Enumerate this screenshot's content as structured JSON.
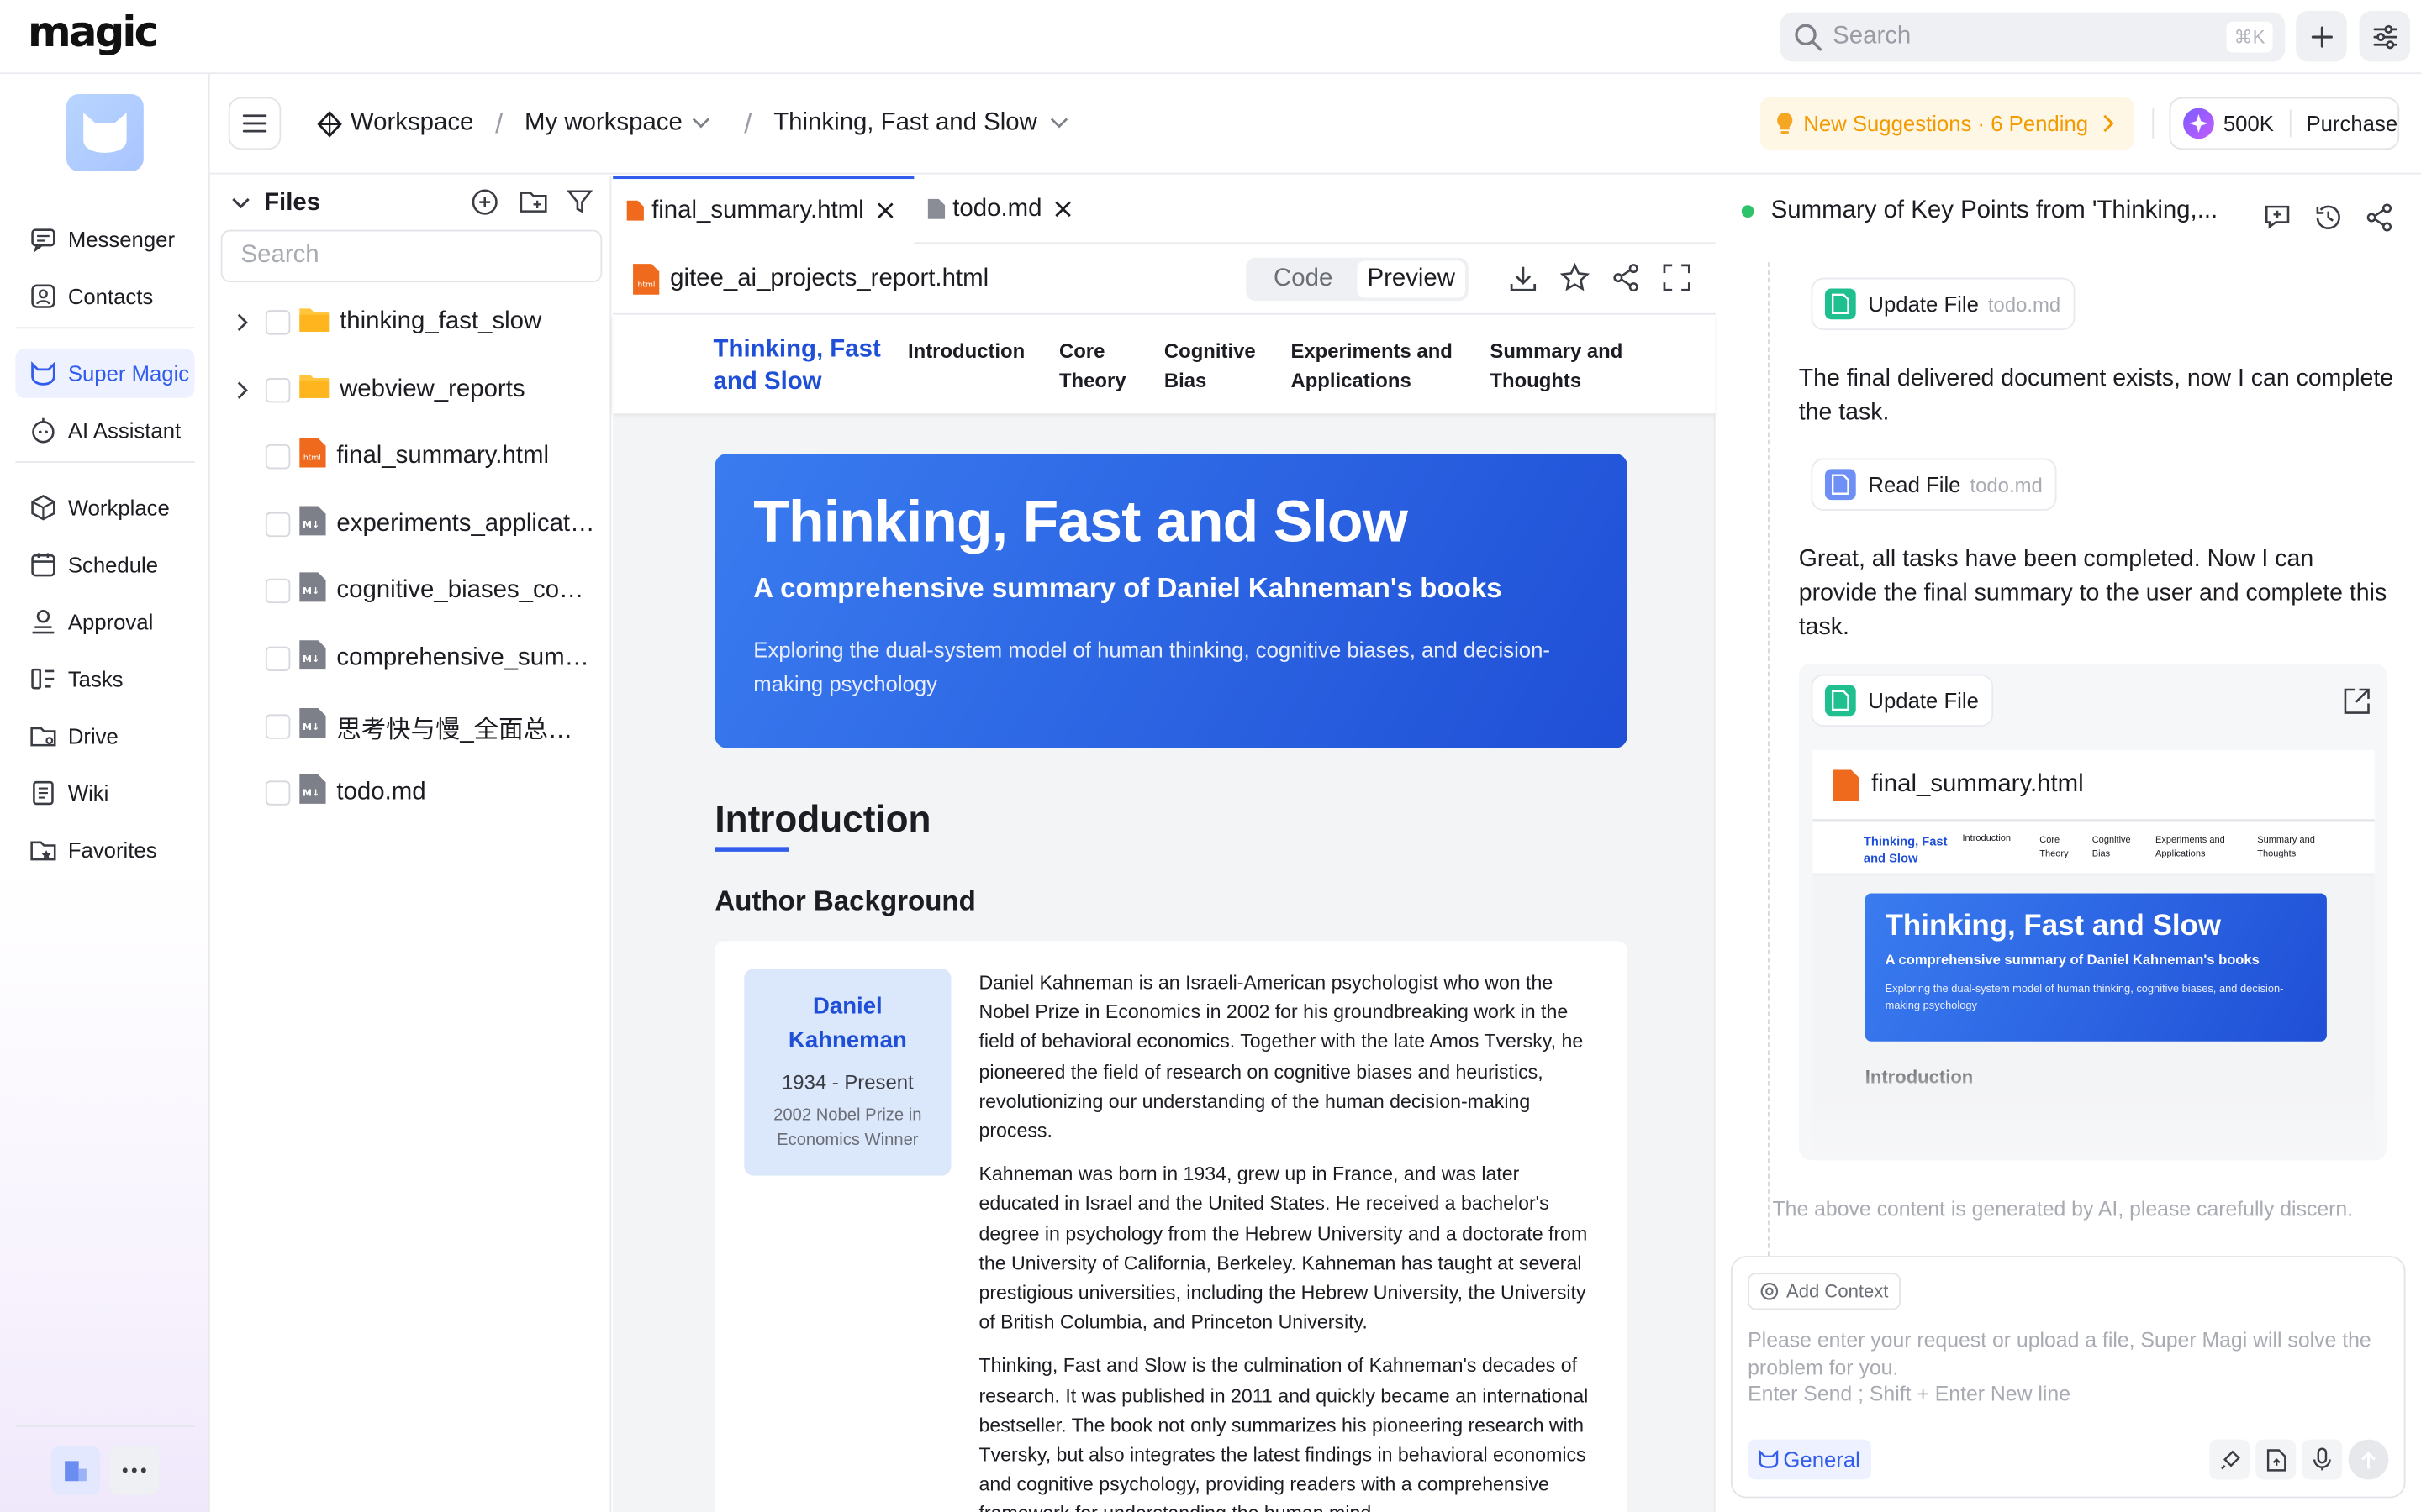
{
  "app": {
    "logo": "magic"
  },
  "topbar": {
    "search_placeholder": "Search",
    "search_shortcut": "⌘K"
  },
  "nav": {
    "items": [
      {
        "label": "Messenger",
        "icon": "message-icon"
      },
      {
        "label": "Contacts",
        "icon": "contacts-icon"
      },
      {
        "label": "Super Magic",
        "icon": "super-magic-icon",
        "active": true
      },
      {
        "label": "AI Assistant",
        "icon": "ai-assistant-icon"
      },
      {
        "label": "Workplace",
        "icon": "workplace-icon"
      },
      {
        "label": "Schedule",
        "icon": "calendar-icon"
      },
      {
        "label": "Approval",
        "icon": "approval-icon"
      },
      {
        "label": "Tasks",
        "icon": "tasks-icon"
      },
      {
        "label": "Drive",
        "icon": "drive-icon"
      },
      {
        "label": "Wiki",
        "icon": "wiki-icon"
      },
      {
        "label": "Favorites",
        "icon": "favorites-icon"
      }
    ]
  },
  "breadcrumb": {
    "root": "Workspace",
    "workspace": "My workspace",
    "project": "Thinking, Fast and Slow"
  },
  "suggestions": {
    "label": "New Suggestions · 6 Pending"
  },
  "credits": {
    "amount": "500K",
    "purchase": "Purchase"
  },
  "files": {
    "title": "Files",
    "search_placeholder": "Search",
    "items": [
      {
        "name": "thinking_fast_slow",
        "type": "folder"
      },
      {
        "name": "webview_reports",
        "type": "folder"
      },
      {
        "name": "final_summary.html",
        "type": "html"
      },
      {
        "name": "experiments_applications.md",
        "type": "md"
      },
      {
        "name": "cognitive_biases_connections.md",
        "type": "md"
      },
      {
        "name": "comprehensive_summary.md",
        "type": "md"
      },
      {
        "name": "思考快与慢_全面总结.md",
        "type": "md"
      },
      {
        "name": "todo.md",
        "type": "md"
      }
    ]
  },
  "editor": {
    "tabs": [
      {
        "label": "final_summary.html",
        "active": true
      },
      {
        "label": "todo.md",
        "active": false
      }
    ],
    "path": "gitee_ai_projects_report.html",
    "mode_code": "Code",
    "mode_preview": "Preview"
  },
  "doc": {
    "brand": "Thinking, Fast and Slow",
    "nav": [
      "Introduction",
      "Core Theory",
      "Cognitive Bias",
      "Experiments and Applications",
      "Summary and Thoughts"
    ],
    "hero_title": "Thinking, Fast and Slow",
    "hero_subtitle": "A comprehensive summary of Daniel Kahneman's books",
    "hero_desc": "Exploring the dual-system model of human thinking, cognitive biases, and decision-making psychology",
    "intro": "Introduction",
    "author_heading": "Author Background",
    "author_name": "Daniel Kahneman",
    "author_years": "1934 - Present",
    "author_award": "2002 Nobel Prize in Economics Winner",
    "bio": [
      "Daniel Kahneman is an Israeli-American psychologist who won the Nobel Prize in Economics in 2002 for his groundbreaking work in the field of behavioral economics. Together with the late Amos Tversky, he pioneered the field of research on cognitive biases and heuristics, revolutionizing our understanding of the human decision-making process.",
      "Kahneman was born in 1934, grew up in France, and was later educated in Israel and the United States. He received a bachelor's degree in psychology from the Hebrew University and a doctorate from the University of California, Berkeley. Kahneman has taught at several prestigious universities, including the Hebrew University, the University of British Columbia, and Princeton University.",
      "Thinking, Fast and Slow is the culmination of Kahneman's decades of research. It was published in 2011 and quickly became an international bestseller. The book not only summarizes his pioneering research with Tversky, but also integrates the latest findings in behavioral economics and cognitive psychology, providing readers with a comprehensive framework for understanding the human mind."
    ]
  },
  "chat": {
    "title": "Summary of Key Points from 'Thinking,...",
    "tool1": {
      "label": "Update File",
      "file": "todo.md"
    },
    "msg1": "The final delivered document exists, now I can complete the task.",
    "tool2": {
      "label": "Read File",
      "file": "todo.md"
    },
    "msg2": "Great, all tasks have been completed. Now I can provide the final summary to the user and complete this task.",
    "tool3": {
      "label": "Update File"
    },
    "card_file": "final_summary.html",
    "disclaimer": "The above content is generated by AI, please carefully discern.",
    "add_context": "Add Context",
    "input_placeholder": "Please enter your request or upload a file, Super Magi will solve the problem for you.",
    "input_hint": "Enter Send ; Shift + Enter New line",
    "mode": "General"
  },
  "colors": {
    "accent": "#315cec",
    "warning": "#f29a00",
    "hero_start": "#3a7cf0",
    "hero_end": "#1f4fd6"
  }
}
